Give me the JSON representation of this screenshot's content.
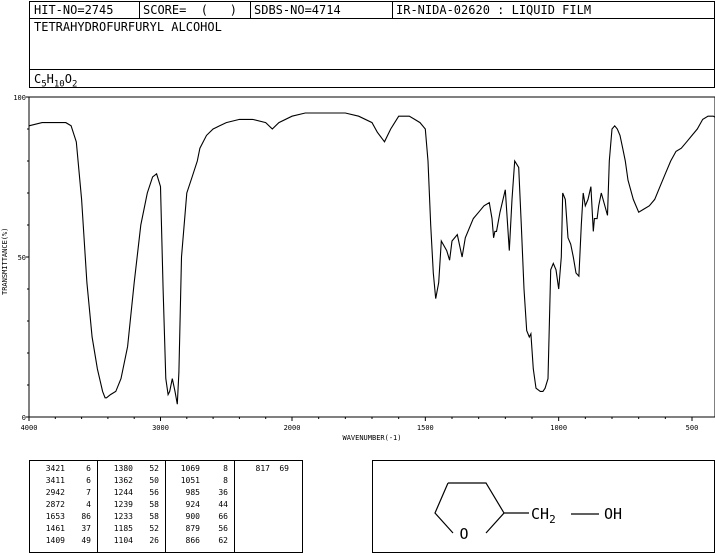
{
  "header": {
    "hit_no": "HIT-NO=2745",
    "score": "SCORE=  (   )",
    "sdbs_no": "SDBS-NO=4714",
    "ir_method": "IR-NIDA-02620 : LIQUID FILM",
    "compound_name": "TETRAHYDROFURFURYL ALCOHOL",
    "formula_base": "C",
    "formula_sub1": "5",
    "formula_h": "H",
    "formula_sub2": "10",
    "formula_o": "O",
    "formula_sub3": "2"
  },
  "chart_data": {
    "type": "line",
    "ylabel": "TRANSMITTANCE(%)",
    "xlabel": "WAVENUMBER(-1)",
    "xlim": [
      4000,
      400
    ],
    "ylim": [
      0,
      100
    ],
    "x_ticks": [
      "4000",
      "3000",
      "2000",
      "1500",
      "1000",
      "500"
    ],
    "y_ticks": [
      "100",
      "50",
      "0"
    ],
    "series": [
      {
        "x": [
          4000,
          3900,
          3800,
          3720,
          3680,
          3640,
          3600,
          3560,
          3520,
          3480,
          3440,
          3421,
          3411,
          3380,
          3340,
          3300,
          3250,
          3200,
          3150,
          3100,
          3060,
          3030,
          3000,
          2980,
          2960,
          2942,
          2930,
          2910,
          2890,
          2872,
          2860,
          2840,
          2800,
          2760,
          2720,
          2700,
          2650,
          2600,
          2550,
          2500,
          2400,
          2300,
          2200,
          2150,
          2100,
          2000,
          1950,
          1900,
          1850,
          1800,
          1750,
          1700,
          1680,
          1653,
          1630,
          1600,
          1560,
          1540,
          1520,
          1500,
          1490,
          1480,
          1470,
          1461,
          1450,
          1440,
          1420,
          1409,
          1400,
          1380,
          1362,
          1350,
          1320,
          1300,
          1280,
          1260,
          1250,
          1244,
          1239,
          1233,
          1220,
          1200,
          1185,
          1175,
          1165,
          1150,
          1140,
          1130,
          1120,
          1110,
          1104,
          1095,
          1085,
          1069,
          1059,
          1051,
          1040,
          1030,
          1020,
          1010,
          1000,
          990,
          985,
          975,
          965,
          955,
          945,
          935,
          924,
          915,
          908,
          900,
          890,
          879,
          870,
          866,
          856,
          850,
          840,
          817,
          810,
          800,
          790,
          780,
          770,
          760,
          750,
          740,
          720,
          700,
          680,
          660,
          640,
          620,
          600,
          580,
          560,
          540,
          520,
          500,
          480,
          460,
          440,
          420,
          400
        ],
        "values": [
          91,
          92,
          92,
          92,
          91,
          86,
          68,
          42,
          25,
          15,
          8,
          6,
          6,
          7,
          8,
          12,
          22,
          42,
          60,
          70,
          75,
          76,
          72,
          40,
          12,
          7,
          8,
          12,
          8,
          4,
          14,
          50,
          70,
          75,
          80,
          84,
          88,
          90,
          91,
          92,
          93,
          93,
          92,
          90,
          92,
          94,
          95,
          95,
          95,
          95,
          94,
          92,
          89,
          86,
          90,
          94,
          94,
          93,
          92,
          90,
          80,
          60,
          45,
          37,
          42,
          55,
          52,
          49,
          55,
          57,
          50,
          56,
          62,
          64,
          66,
          67,
          62,
          56,
          58,
          58,
          64,
          71,
          52,
          68,
          80,
          78,
          60,
          40,
          27,
          25,
          26,
          15,
          9,
          8,
          8,
          9,
          12,
          46,
          48,
          46,
          40,
          50,
          70,
          68,
          56,
          54,
          50,
          45,
          44,
          60,
          70,
          66,
          68,
          72,
          58,
          62,
          62,
          66,
          70,
          63,
          80,
          90,
          91,
          90,
          88,
          84,
          80,
          74,
          68,
          64,
          65,
          66,
          68,
          72,
          76,
          80,
          83,
          84,
          86,
          88,
          90,
          93,
          94,
          94,
          93
        ],
        "name": ""
      }
    ]
  },
  "peak_table": {
    "columns": [
      [
        [
          "3421",
          "6"
        ],
        [
          "3411",
          "6"
        ],
        [
          "2942",
          "7"
        ],
        [
          "2872",
          "4"
        ],
        [
          "1653",
          "86"
        ],
        [
          "1461",
          "37"
        ],
        [
          "1409",
          "49"
        ]
      ],
      [
        [
          "1380",
          "52"
        ],
        [
          "1362",
          "50"
        ],
        [
          "1244",
          "56"
        ],
        [
          "1239",
          "58"
        ],
        [
          "1233",
          "58"
        ],
        [
          "1185",
          "52"
        ],
        [
          "1104",
          "26"
        ]
      ],
      [
        [
          "1069",
          "8"
        ],
        [
          "1051",
          "8"
        ],
        [
          "985",
          "36"
        ],
        [
          "924",
          "44"
        ],
        [
          "900",
          "66"
        ],
        [
          "879",
          "56"
        ],
        [
          "866",
          "62"
        ]
      ],
      [
        [
          "817",
          "69"
        ]
      ]
    ]
  },
  "structure": {
    "oxygen_ring": "O",
    "ch2_c": "CH",
    "ch2_sub": "2",
    "oh": "OH"
  }
}
